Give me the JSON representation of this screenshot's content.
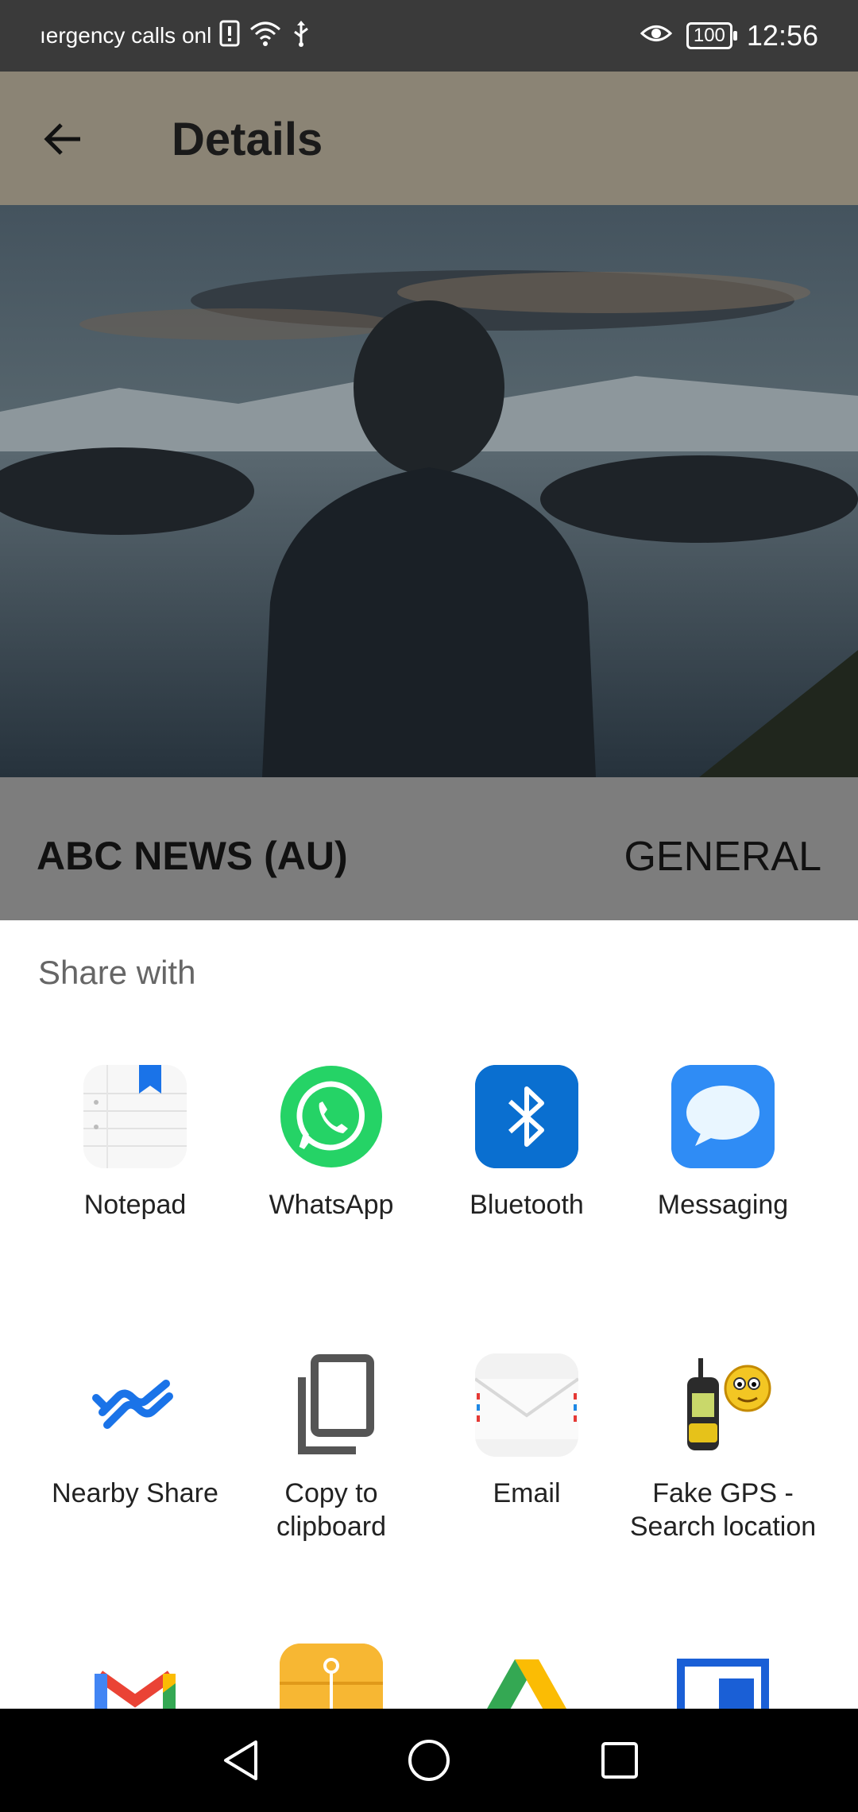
{
  "status_bar": {
    "carrier_text": "ıergency calls onl",
    "battery": "100",
    "time": "12:56"
  },
  "app_bar": {
    "title": "Details"
  },
  "article": {
    "source": "ABC NEWS (AU)",
    "category": "GENERAL"
  },
  "share_sheet": {
    "title": "Share with",
    "items": [
      {
        "label": "Notepad",
        "icon": "notepad-icon"
      },
      {
        "label": "WhatsApp",
        "icon": "whatsapp-icon"
      },
      {
        "label": "Bluetooth",
        "icon": "bluetooth-icon"
      },
      {
        "label": "Messaging",
        "icon": "messaging-icon"
      },
      {
        "label": "Nearby Share",
        "icon": "nearby-share-icon"
      },
      {
        "label": "Copy to\nclipboard",
        "icon": "copy-icon"
      },
      {
        "label": "Email",
        "icon": "email-icon"
      },
      {
        "label": "Fake GPS -\nSearch location",
        "icon": "fake-gps-icon"
      },
      {
        "label": "",
        "icon": "gmail-icon"
      },
      {
        "label": "",
        "icon": "archive-icon"
      },
      {
        "label": "",
        "icon": "drive-icon"
      },
      {
        "label": "",
        "icon": "window-icon"
      }
    ]
  },
  "colors": {
    "whatsapp": "#25D366",
    "bluetooth": "#0a6fd0",
    "messaging": "#2f8cf5",
    "nearby": "#1a73e8"
  }
}
